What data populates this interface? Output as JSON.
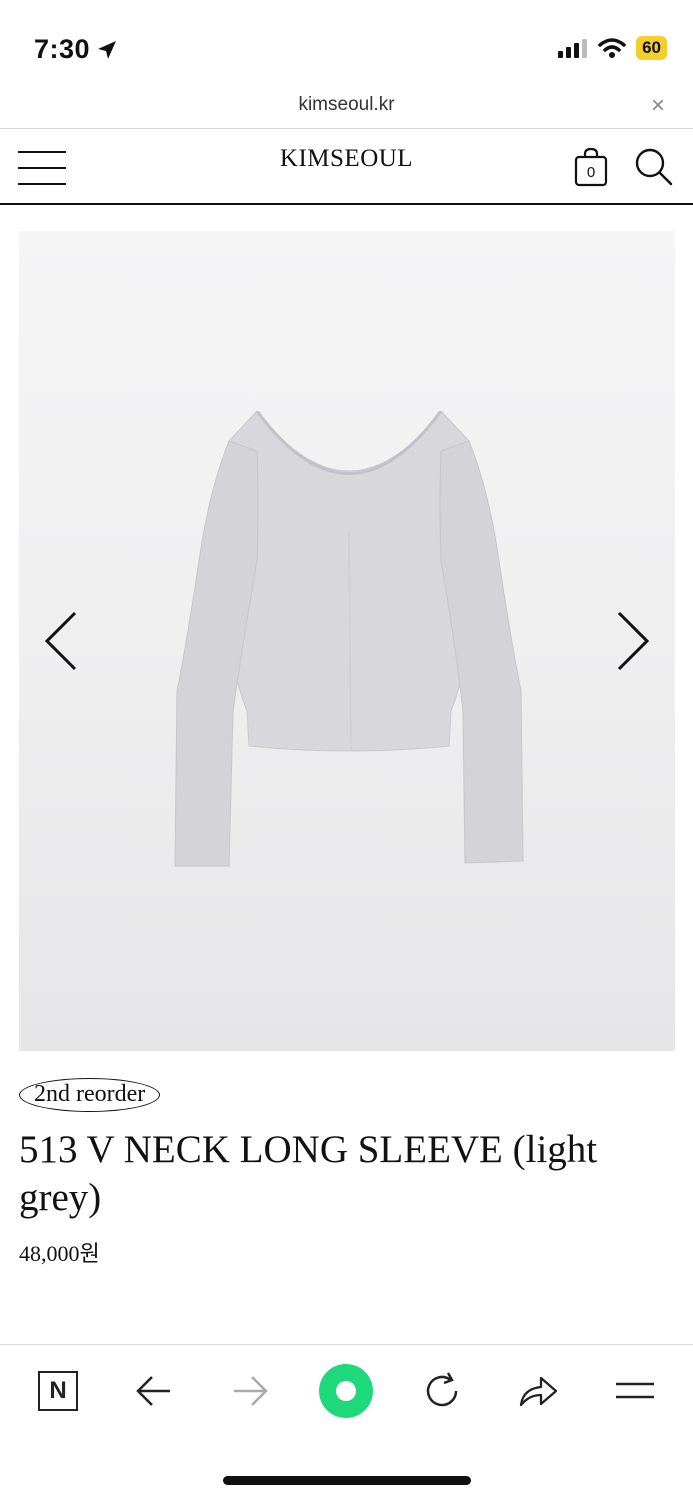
{
  "status_bar": {
    "time": "7:30",
    "battery": "60",
    "battery_color": "#f4cf2c"
  },
  "url_bar": {
    "url": "kimseoul.kr",
    "close_label": "×"
  },
  "header": {
    "logo": "KIMSEOUL",
    "cart_count": "0"
  },
  "product": {
    "badge": "2nd reorder",
    "title": "513 V NECK LONG SLEEVE (light grey)",
    "price": "48,000원",
    "image_alt": "light grey v-neck long sleeve top"
  },
  "toolbar": {
    "n_label": "N",
    "accent": "#1fd87a"
  }
}
